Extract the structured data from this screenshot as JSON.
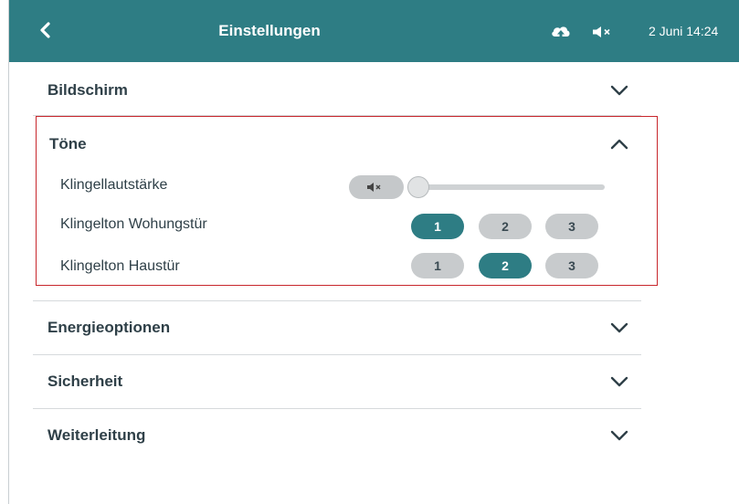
{
  "header": {
    "title": "Einstellungen",
    "back_icon": "chevron-left-icon",
    "cloud_icon": "cloud-upload-icon",
    "mute_icon": "speaker-muted-icon",
    "datetime": "2 Juni 14:24"
  },
  "sections": {
    "bildschirm": "Bildschirm",
    "toene": "Töne",
    "energie": "Energieoptionen",
    "sicherheit": "Sicherheit",
    "weiterleitung": "Weiterleitung"
  },
  "toene": {
    "klingellautstaerke": {
      "label": "Klingellautstärke",
      "muted": true,
      "volume": 0
    },
    "wohnungstuer": {
      "label": "Klingelton Wohungstür",
      "options": [
        "1",
        "2",
        "3"
      ],
      "selected": "1"
    },
    "haustuer": {
      "label": "Klingelton Haustür",
      "options": [
        "1",
        "2",
        "3"
      ],
      "selected": "2"
    }
  },
  "colors": {
    "accent": "#2e7d84",
    "highlight_border": "#c8262c",
    "button_inactive": "#c8cbcd"
  }
}
